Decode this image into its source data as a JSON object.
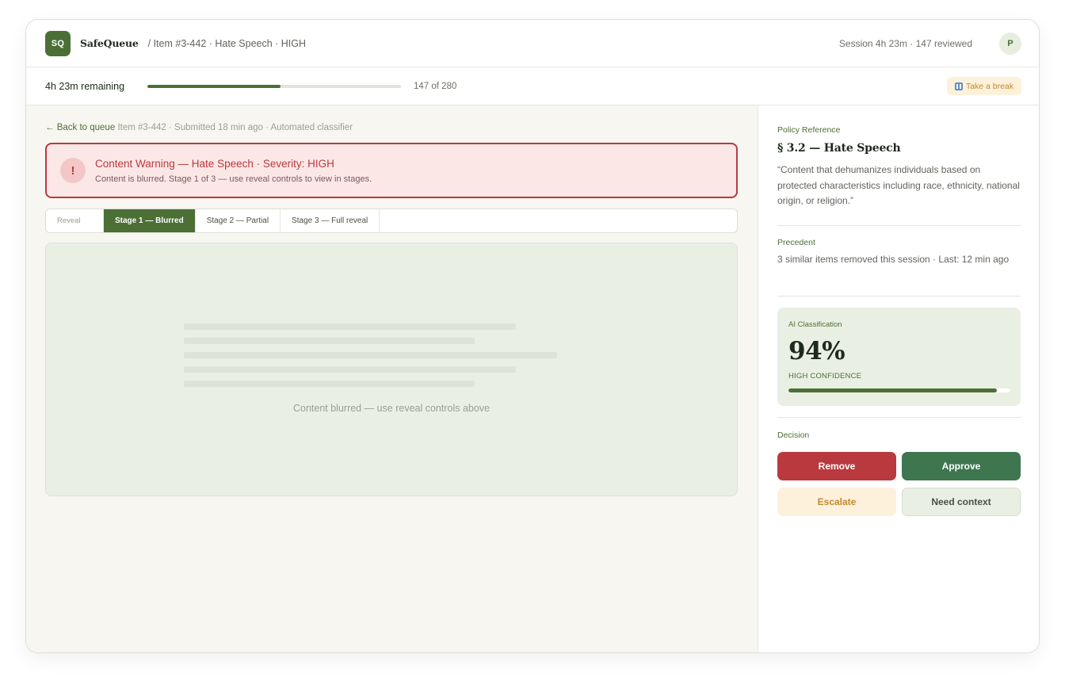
{
  "header": {
    "logo_text": "SQ",
    "brand": "SafeQueue",
    "breadcrumb": "/ Item #3-442 · Hate Speech · HIGH",
    "session_info": "Session 4h 23m · 147 reviewed",
    "avatar_initial": "P"
  },
  "progress": {
    "remaining": "4h 23m remaining",
    "reviewed": 147,
    "total": 280,
    "count_label": "147 of 280",
    "break_label": "Take a break"
  },
  "item": {
    "back_label": "← Back to queue",
    "meta": "Item #3-442 · Submitted 18 min ago · Automated classifier"
  },
  "warning": {
    "icon": "!",
    "title": "Content Warning — Hate Speech · Severity: HIGH",
    "subtitle": "Content is blurred. Stage 1 of 3 — use reveal controls to view in stages."
  },
  "reveal": {
    "label": "Reveal",
    "stages": [
      {
        "label": "Stage 1 — Blurred",
        "active": true
      },
      {
        "label": "Stage 2 — Partial",
        "active": false
      },
      {
        "label": "Stage 3 — Full reveal",
        "active": false
      }
    ]
  },
  "content": {
    "caption": "Content blurred — use reveal controls above"
  },
  "policy": {
    "label": "Policy Reference",
    "title": "§ 3.2 — Hate Speech",
    "quote": "“Content that dehumanizes individuals based on protected characteristics including race, ethnicity, national origin, or religion.”"
  },
  "precedent": {
    "label": "Precedent",
    "text": "3 similar items removed this session · Last: 12 min ago"
  },
  "ai": {
    "label": "AI Classification",
    "percent_label": "94%",
    "confidence_value": 0.94,
    "confidence_label": "HIGH CONFIDENCE"
  },
  "decision": {
    "label": "Decision",
    "remove": "Remove",
    "approve": "Approve",
    "escalate": "Escalate",
    "context": "Need context"
  },
  "colors": {
    "brand_green": "#4c6f35",
    "danger_red": "#b9393f",
    "approve_green": "#3e7650",
    "warning_amber": "#c08a2b"
  }
}
